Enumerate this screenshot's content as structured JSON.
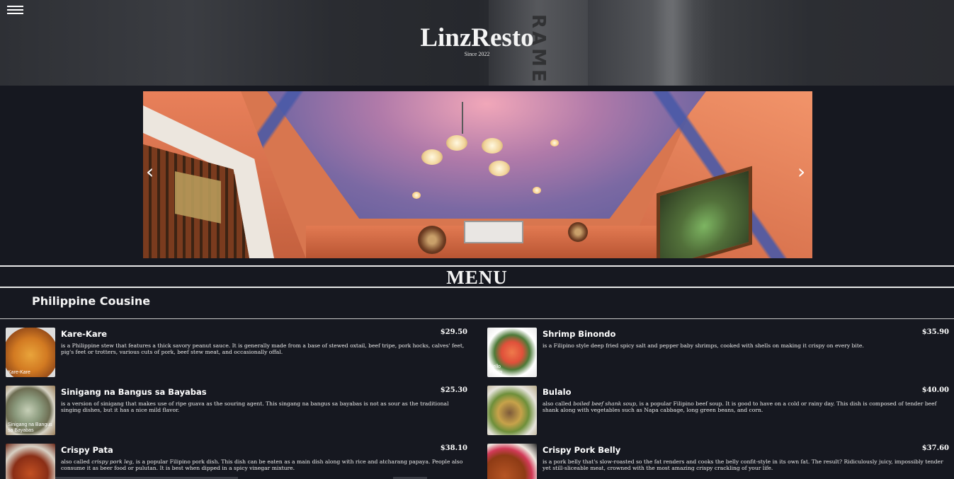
{
  "header": {
    "brand": "LinzResto",
    "tagline": "Since 2022",
    "background_text": "RAMEN"
  },
  "carousel": {
    "prev_icon": "chevron-left-icon",
    "next_icon": "chevron-right-icon",
    "prev_glyph": "‹",
    "next_glyph": "›"
  },
  "menu": {
    "title": "MENU",
    "category": "Philippine Cousine",
    "items": [
      {
        "name": "Kare-Kare",
        "price": "$29.50",
        "image_caption": "Kare-Kare",
        "desc": "is a Philippine stew that features a thick savory peanut sauce. It is generally made from a base of stewed oxtail, beef tripe, pork hocks, calves' feet, pig's feet or trotters, various cuts of pork, beef stew meat, and occasionally offal."
      },
      {
        "name": "Shrimp Binondo",
        "price": "$35.90",
        "image_caption": "Hello Photo",
        "desc": "is a Filipino style deep fried spicy salt and pepper baby shrimps, cooked with shells on making it crispy on every bite."
      },
      {
        "name": "Sinigang na Bangus sa Bayabas",
        "price": "$25.30",
        "image_caption": "Sinigang na Bangus sa Bayabas",
        "desc": "is a version of sinigang that makes use of ripe guava as the souring agent. This singang na bangus sa bayabas is not as sour as the traditional singing dishes, but it has a nice mild flavor."
      },
      {
        "name": "Bulalo",
        "price": "$40.00",
        "image_caption": "",
        "desc_prefix": "also called ",
        "desc_emphasis": "boiled beef shank soup",
        "desc_suffix": ", is a popular Filipino beef soup. It is good to have on a cold or rainy day. This dish is composed of tender beef shank along with vegetables such as Napa cabbage, long green beans, and corn."
      },
      {
        "name": "Crispy Pata",
        "price": "$38.10",
        "image_caption": "",
        "desc_prefix": "also called ",
        "desc_emphasis": "crispy pork leg",
        "desc_suffix": ", is a popular Filipino pork dish. This dish can be eaten as a main dish along with rice and atcharang papaya. People also consume it as beer food or pulutan. It is best when dipped in a spicy vinegar mixture."
      },
      {
        "name": "Crispy Pork Belly",
        "price": "$37.60",
        "image_caption": "",
        "desc": "is a pork belly that's slow-roasted so the fat renders and cooks the belly confit-style in its own fat. The result? Ridiculously juicy, impossibly tender yet still-sliceable meat, crowned with the most amazing crispy crackling of your life."
      }
    ]
  }
}
